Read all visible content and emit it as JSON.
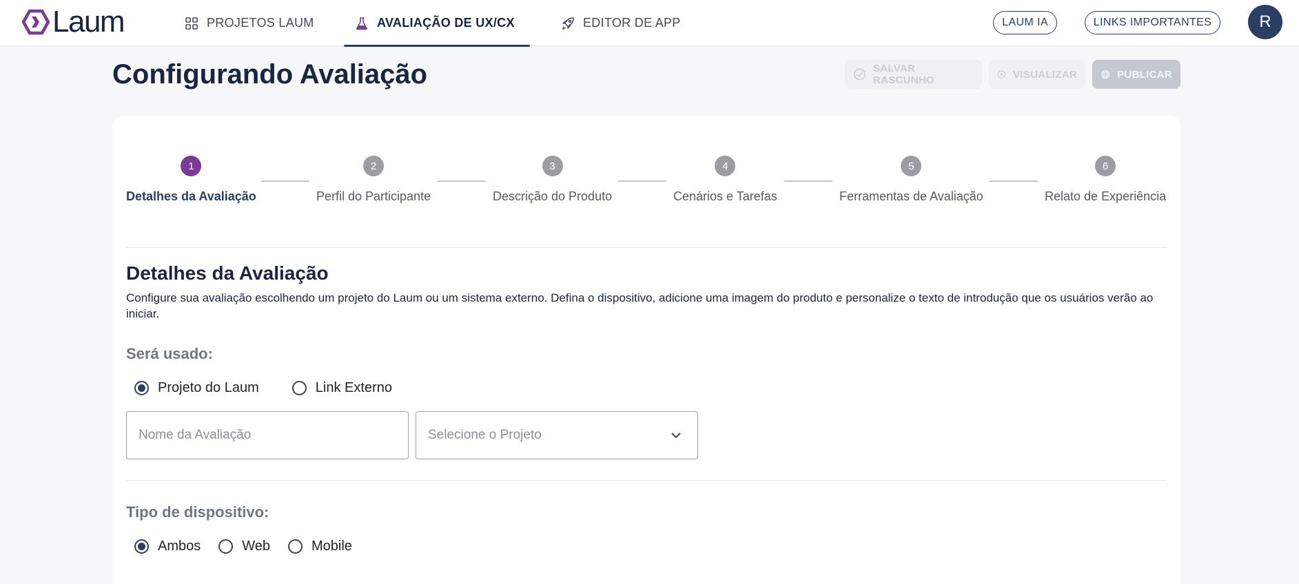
{
  "brand": {
    "name": "Laum",
    "accent": "#7b3a96",
    "primary": "#2a3f5f"
  },
  "nav": {
    "items": [
      {
        "label": "PROJETOS LAUM",
        "icon": "grid-icon"
      },
      {
        "label": "AVALIAÇÃO DE UX/CX",
        "icon": "flask-icon",
        "active": true
      },
      {
        "label": "EDITOR DE APP",
        "icon": "rocket-icon"
      }
    ],
    "laum_ia_label": "LAUM IA",
    "links_label": "LINKS IMPORTANTES",
    "avatar_initial": "R"
  },
  "page": {
    "title": "Configurando Avaliação",
    "actions": {
      "salvar": "SALVAR RASCUNHO",
      "visualizar": "VISUALIZAR",
      "publicar": "PUBLICAR"
    }
  },
  "steps": [
    {
      "number": "1",
      "label": "Detalhes da Avaliação",
      "active": true
    },
    {
      "number": "2",
      "label": "Perfil do Participante"
    },
    {
      "number": "3",
      "label": "Descrição do Produto"
    },
    {
      "number": "4",
      "label": "Cenários e Tarefas"
    },
    {
      "number": "5",
      "label": "Ferramentas de Avaliação"
    },
    {
      "number": "6",
      "label": "Relato de Experiência"
    }
  ],
  "section": {
    "title": "Detalhes da Avaliação",
    "description": "Configure sua avaliação escolhendo um projeto do Laum ou um sistema externo. Defina o dispositivo, adicione uma imagem do produto e personalize o texto de introdução que os usuários verão ao iniciar."
  },
  "source": {
    "label": "Será usado:",
    "options": [
      "Projeto do Laum",
      "Link Externo"
    ],
    "selected": "Projeto do Laum"
  },
  "form": {
    "nome_placeholder": "Nome da Avaliação",
    "projeto_placeholder": "Selecione o Projeto"
  },
  "device": {
    "label": "Tipo de dispositivo:",
    "options": [
      "Ambos",
      "Web",
      "Mobile"
    ],
    "selected": "Ambos"
  }
}
